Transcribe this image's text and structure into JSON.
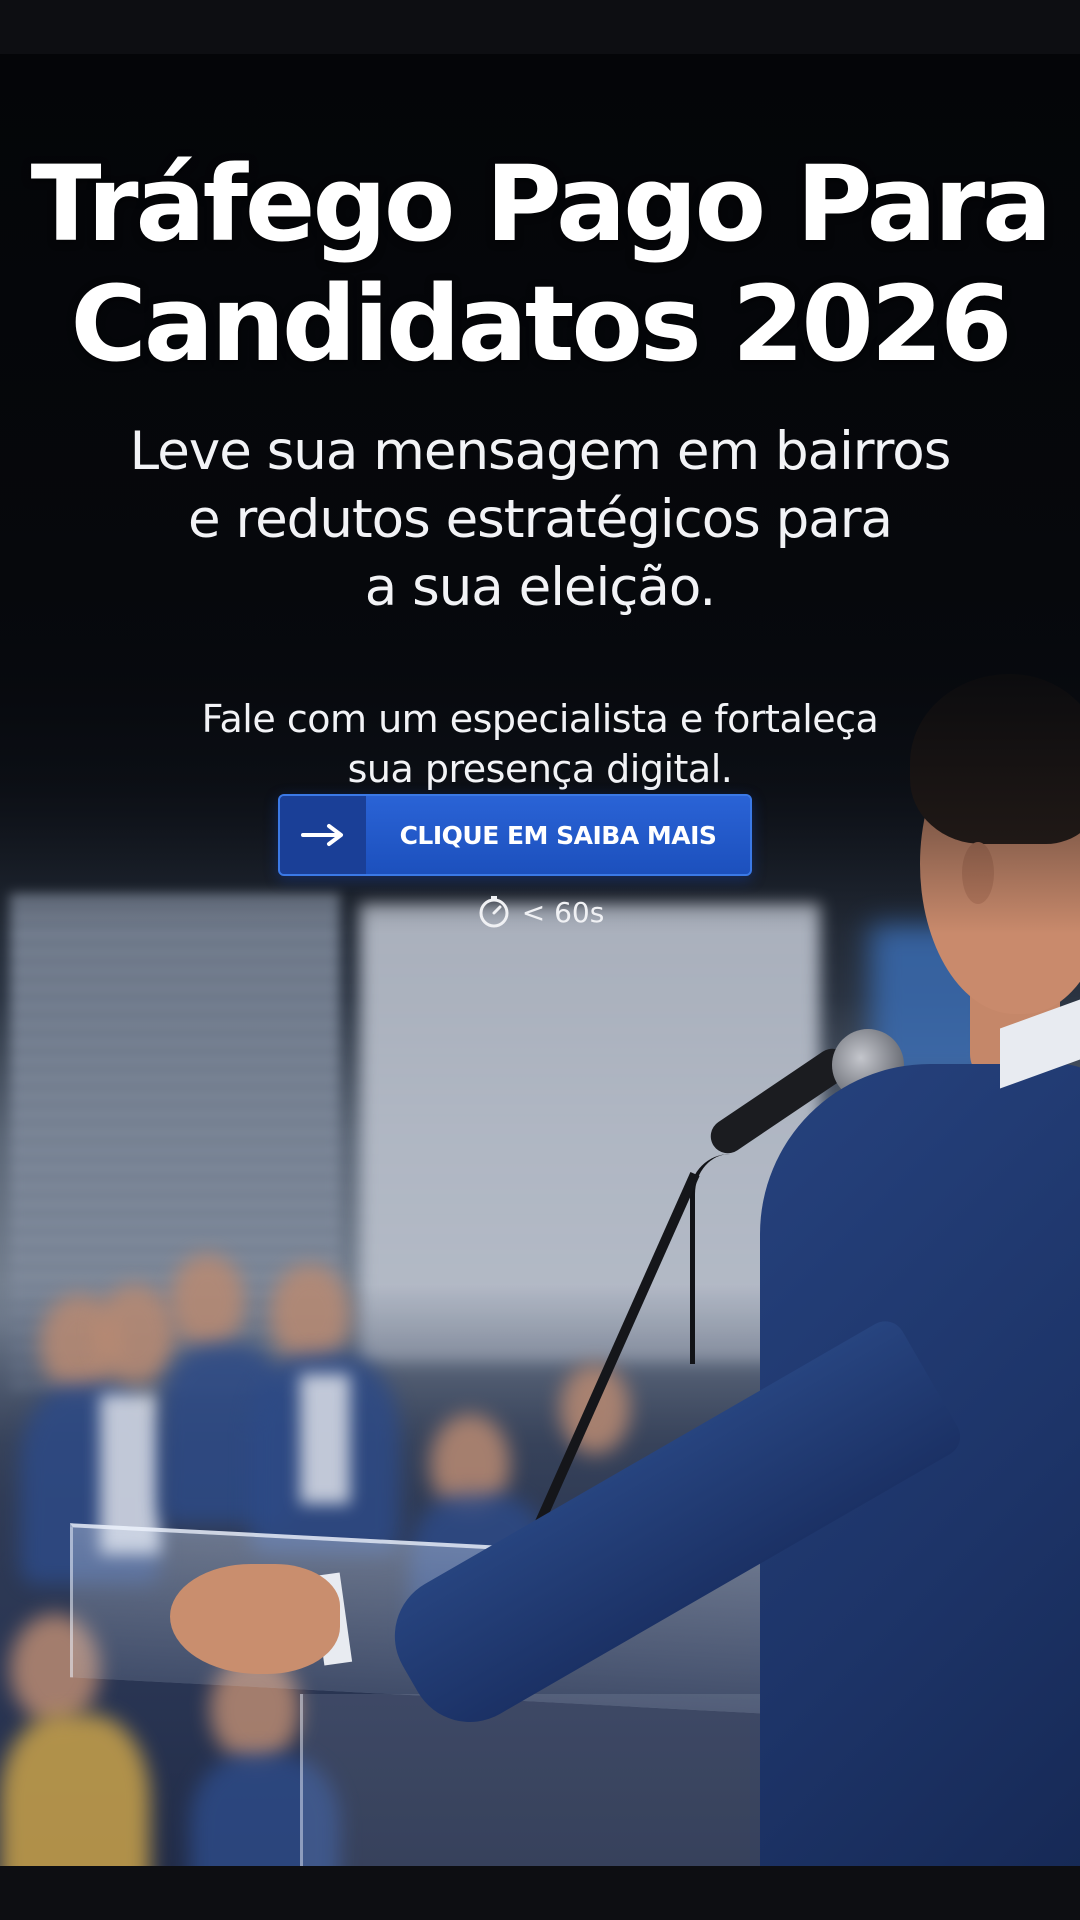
{
  "ad": {
    "headline": [
      "Tráfego Pago Para",
      "Candidatos 2026"
    ],
    "subheadline": [
      "Leve sua mensagem em bairros",
      "e redutos estratégicos para",
      "a sua eleição."
    ],
    "support_text": [
      "Fale com um especialista e fortaleça",
      "sua presença digital."
    ],
    "cta": {
      "arrow_icon": "arrow-right-icon",
      "label": "CLIQUE EM SAIBA MAIS"
    },
    "timer": {
      "icon": "stopwatch-icon",
      "label": "< 60s"
    }
  },
  "colors": {
    "background": "#0d0e12",
    "cta_blue": "#1e56c6",
    "cta_arrow_blue": "#1a3f97",
    "text": "#ffffff"
  }
}
